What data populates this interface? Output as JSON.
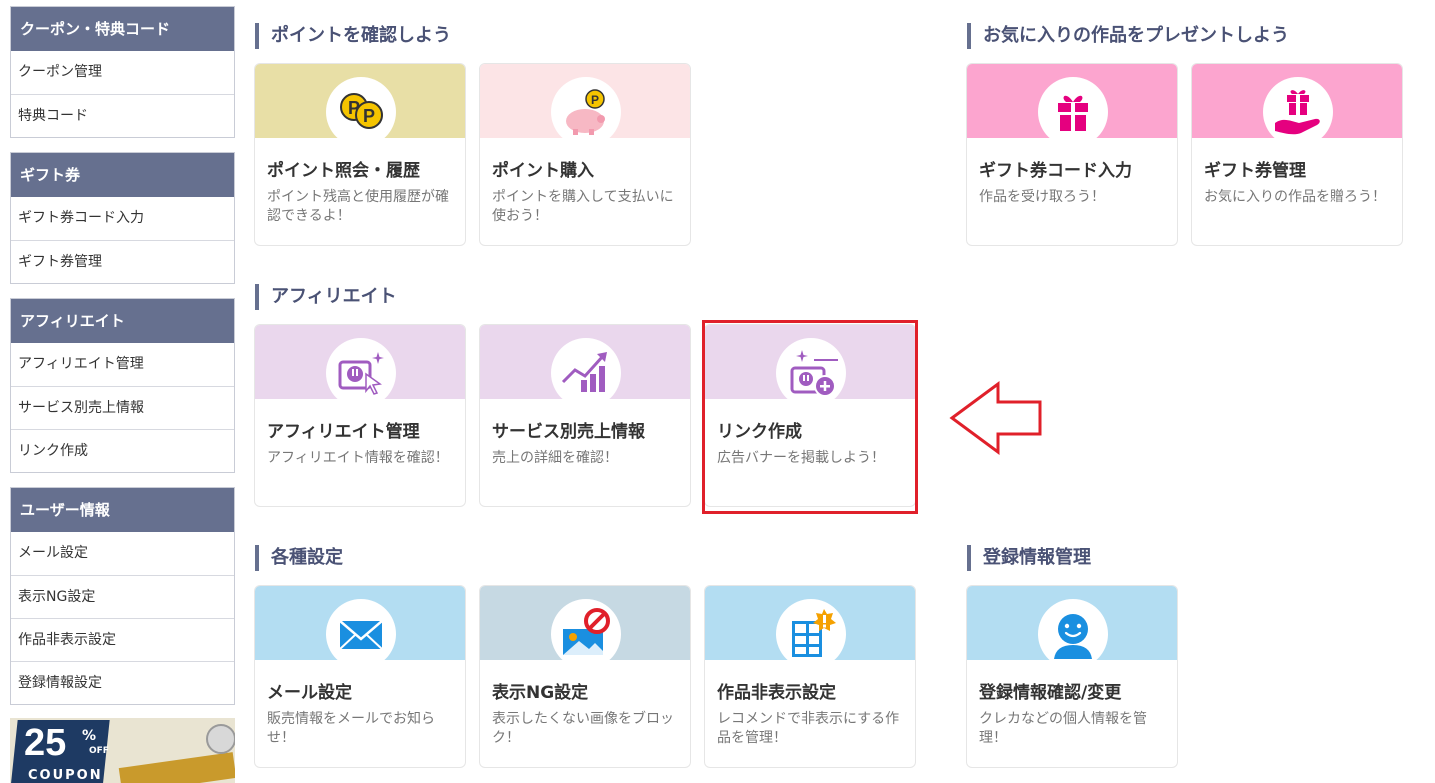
{
  "sidebar": {
    "groups": [
      {
        "title": "クーポン・特典コード",
        "items": [
          "クーポン管理",
          "特典コード"
        ]
      },
      {
        "title": "ギフト券",
        "items": [
          "ギフト券コード入力",
          "ギフト券管理"
        ]
      },
      {
        "title": "アフィリエイト",
        "items": [
          "アフィリエイト管理",
          "サービス別売上情報",
          "リンク作成"
        ]
      },
      {
        "title": "ユーザー情報",
        "items": [
          "メール設定",
          "表示NG設定",
          "作品非表示設定",
          "登録情報設定"
        ]
      }
    ],
    "banner": {
      "percent": "25",
      "percent_sign": "%",
      "off": "OFF",
      "coupon": "COUPON"
    }
  },
  "sections": {
    "points": {
      "title": "ポイントを確認しよう",
      "cards": [
        {
          "title": "ポイント照会・履歴",
          "desc": "ポイント残高と使用履歴が確認できるよ！",
          "icon": "coins-icon"
        },
        {
          "title": "ポイント購入",
          "desc": "ポイントを購入して支払いに使おう！",
          "icon": "piggy-bank-icon"
        }
      ]
    },
    "gift": {
      "title": "お気に入りの作品をプレゼントしよう",
      "cards": [
        {
          "title": "ギフト券コード入力",
          "desc": "作品を受け取ろう！",
          "icon": "gift-icon"
        },
        {
          "title": "ギフト券管理",
          "desc": "お気に入りの作品を贈ろう！",
          "icon": "gift-hand-icon"
        }
      ]
    },
    "affiliate": {
      "title": "アフィリエイト",
      "cards": [
        {
          "title": "アフィリエイト管理",
          "desc": "アフィリエイト情報を確認！",
          "icon": "affiliate-cursor-icon"
        },
        {
          "title": "サービス別売上情報",
          "desc": "売上の詳細を確認！",
          "icon": "sales-chart-icon"
        },
        {
          "title": "リンク作成",
          "desc": "広告バナーを掲載しよう！",
          "icon": "link-create-icon"
        }
      ]
    },
    "settings": {
      "title": "各種設定",
      "cards": [
        {
          "title": "メール設定",
          "desc": "販売情報をメールでお知らせ！",
          "icon": "mail-icon"
        },
        {
          "title": "表示NG設定",
          "desc": "表示したくない画像をブロック！",
          "icon": "image-block-icon"
        },
        {
          "title": "作品非表示設定",
          "desc": "レコメンドで非表示にする作品を管理！",
          "icon": "hide-works-icon"
        }
      ]
    },
    "account": {
      "title": "登録情報管理",
      "cards": [
        {
          "title": "登録情報確認/変更",
          "desc": "クレカなどの個人情報を管理！",
          "icon": "user-icon"
        }
      ]
    }
  },
  "colors": {
    "sidebar_header": "#66708f",
    "highlight": "#e0202a",
    "accent_magenta": "#e5007f",
    "accent_purple": "#a05cc0",
    "accent_blue": "#1a8fe0"
  }
}
